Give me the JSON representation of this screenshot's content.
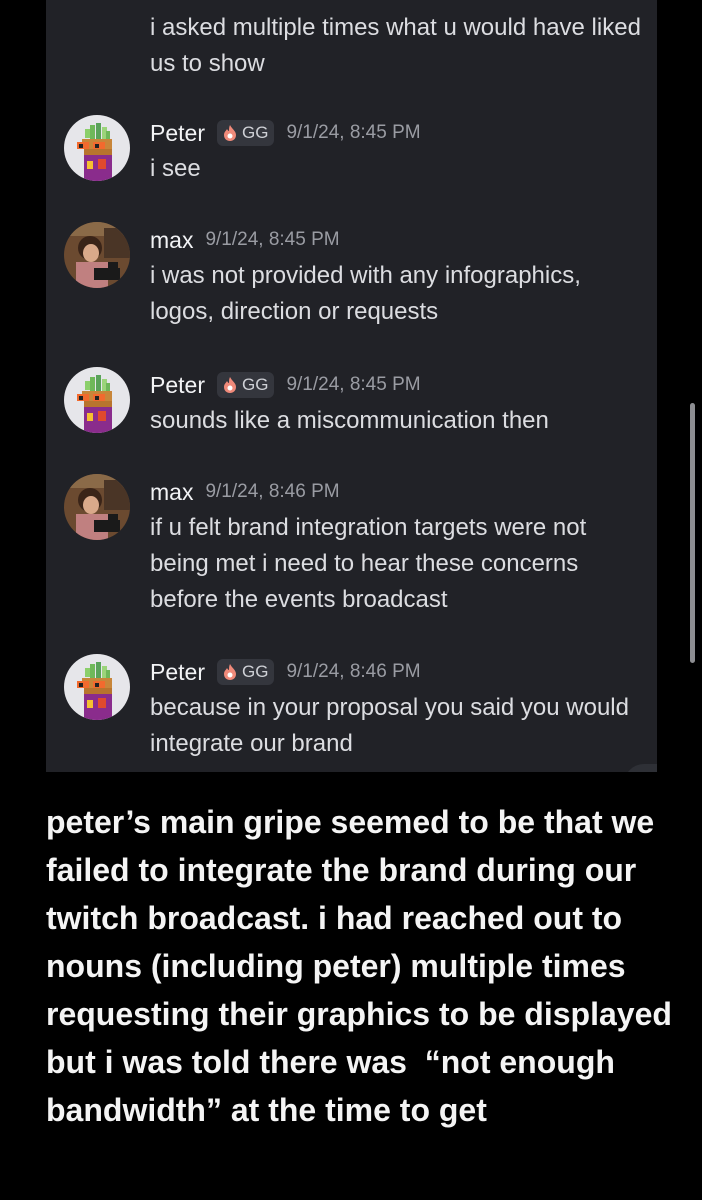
{
  "chat": {
    "previous_message_text": "i asked multiple times what u would have liked us to show",
    "messages": [
      {
        "author": "Peter",
        "tag": "GG",
        "time": "9/1/24, 8:45 PM",
        "text": "i see",
        "avatar": "peter"
      },
      {
        "author": "max",
        "tag": "",
        "time": "9/1/24, 8:45 PM",
        "text": "i was not provided with any infographics, logos, direction or requests",
        "avatar": "max"
      },
      {
        "author": "Peter",
        "tag": "GG",
        "time": "9/1/24, 8:45 PM",
        "text": "sounds like a miscommunication then",
        "avatar": "peter"
      },
      {
        "author": "max",
        "tag": "",
        "time": "9/1/24, 8:46 PM",
        "text": "if u felt brand integration targets were not being met i need to hear these concerns before the events broadcast",
        "avatar": "max"
      },
      {
        "author": "Peter",
        "tag": "GG",
        "time": "9/1/24, 8:46 PM",
        "text": "because in your proposal you said you would integrate our brand",
        "avatar": "peter"
      }
    ]
  },
  "caption": "peter’s main gripe seemed to be that we failed to integrate the brand during our twitch broadcast. i had reached out to nouns (including peter) multiple times requesting their graphics to be displayed but i was told there was  “not enough bandwidth” at the time to get",
  "colors": {
    "chat_background": "#212227",
    "page_background": "#000000",
    "username": "#f2f3f5",
    "message_text": "#dcdde1",
    "timestamp": "#9a9ca3",
    "tag_background": "#34363d",
    "tag_icon": "#f08a7a"
  }
}
